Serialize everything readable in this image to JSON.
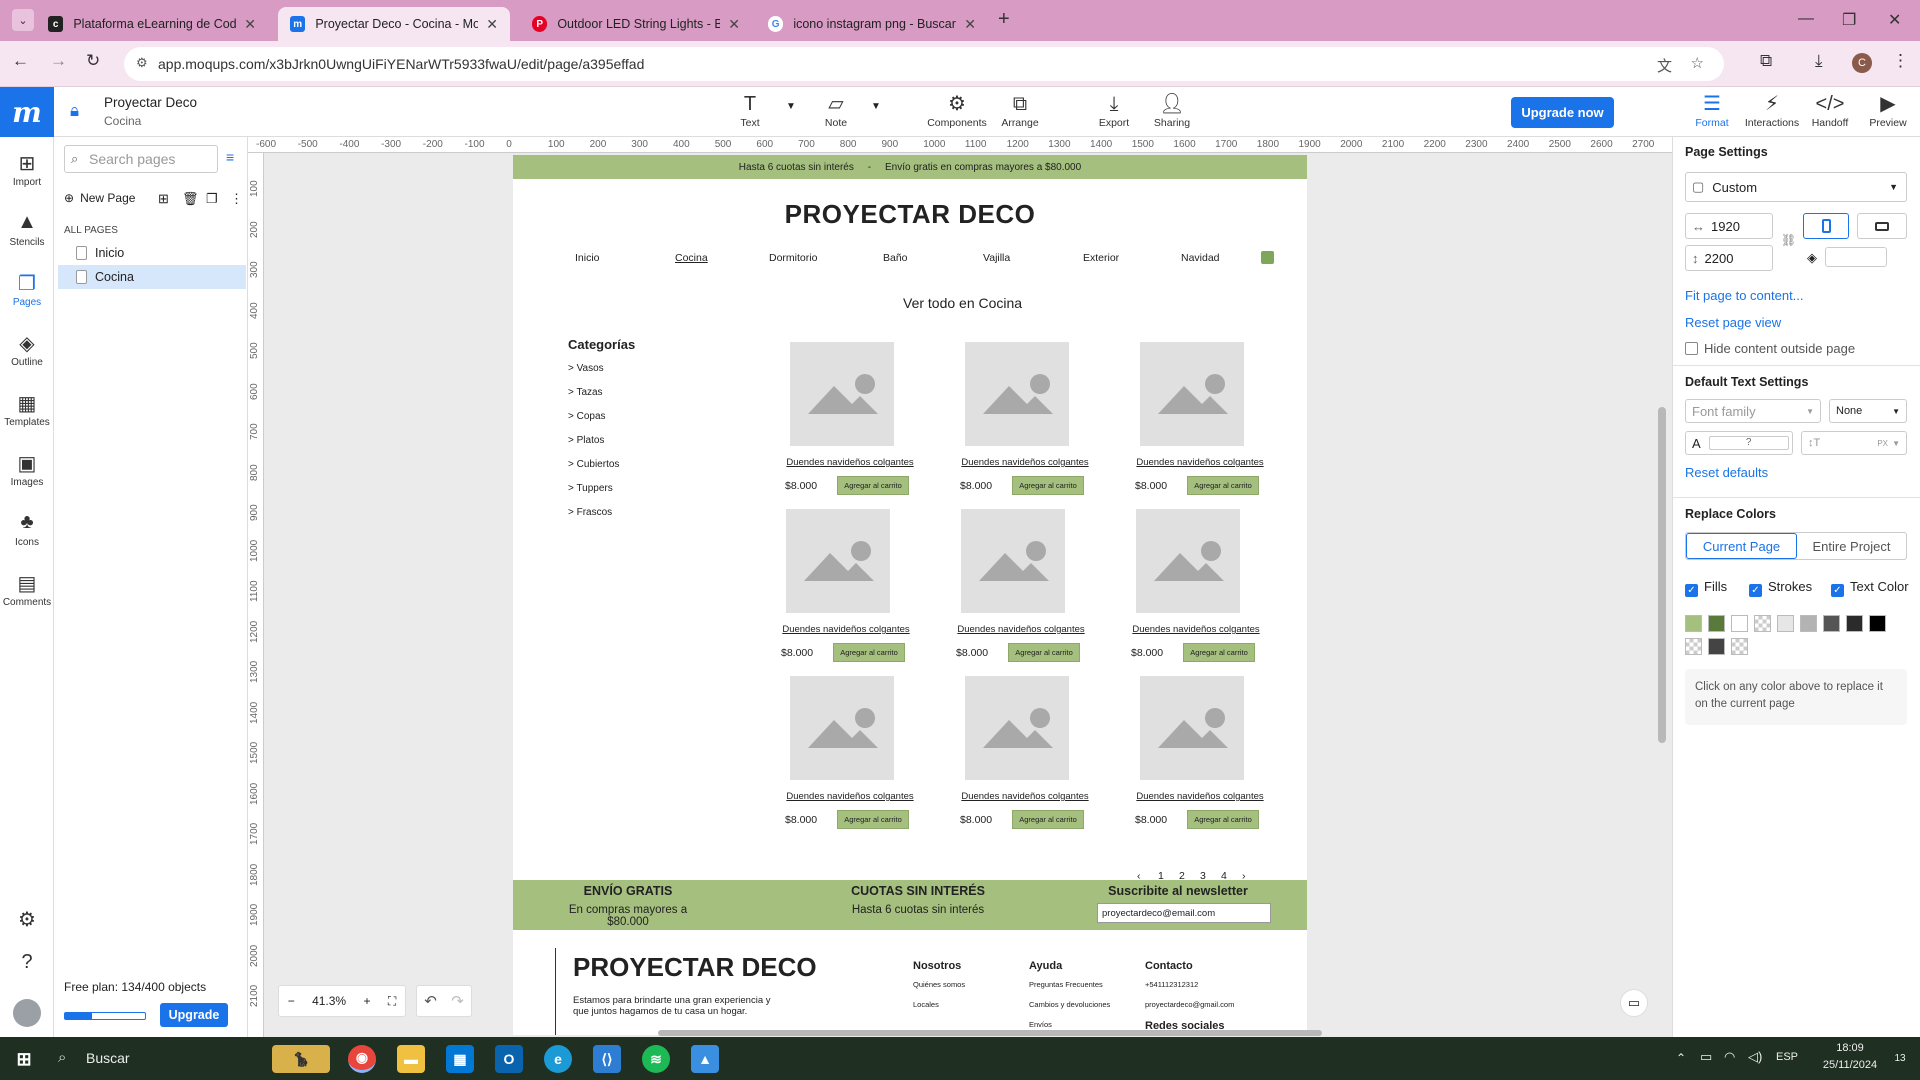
{
  "browser": {
    "tabs": [
      {
        "title": "Plataforma eLearning de Coder",
        "favicon": "coder"
      },
      {
        "title": "Proyectar Deco - Cocina - Moqu",
        "favicon": "moqups",
        "active": true
      },
      {
        "title": "Outdoor LED String Lights - Bla",
        "favicon": "pinterest"
      },
      {
        "title": "icono instagram png - Buscar c",
        "favicon": "google"
      }
    ],
    "new_tab": "+",
    "url": "app.moqups.com/x3bJrkn0UwngUiFiYENarWTr5933fwaU/edit/page/a395effad",
    "profile_initial": "C"
  },
  "app": {
    "logo": "m",
    "project_name": "Proyectar Deco",
    "page_name": "Cocina",
    "toolbar": [
      {
        "label": "Text",
        "icon": "text-icon"
      },
      {
        "label": "Note",
        "icon": "note-icon"
      },
      {
        "label": "Components",
        "icon": "components-icon"
      },
      {
        "label": "Arrange",
        "icon": "arrange-icon"
      },
      {
        "label": "Export",
        "icon": "export-icon"
      },
      {
        "label": "Sharing",
        "icon": "sharing-icon"
      }
    ],
    "upgrade_now": "Upgrade now",
    "right_tools": [
      {
        "label": "Format",
        "icon": "format-icon",
        "active": true
      },
      {
        "label": "Interactions",
        "icon": "interactions-icon"
      },
      {
        "label": "Handoff",
        "icon": "handoff-icon"
      },
      {
        "label": "Preview",
        "icon": "preview-icon"
      }
    ]
  },
  "rail": [
    {
      "label": "Import",
      "icon": "import-icon"
    },
    {
      "label": "Stencils",
      "icon": "stencils-icon"
    },
    {
      "label": "Pages",
      "icon": "pages-icon",
      "active": true
    },
    {
      "label": "Outline",
      "icon": "outline-icon"
    },
    {
      "label": "Templates",
      "icon": "templates-icon"
    },
    {
      "label": "Images",
      "icon": "images-icon"
    },
    {
      "label": "Icons",
      "icon": "icons-icon"
    },
    {
      "label": "Comments",
      "icon": "comments-icon"
    }
  ],
  "pages_panel": {
    "search_placeholder": "Search pages",
    "new_page": "New Page",
    "section": "ALL PAGES",
    "pages": [
      {
        "name": "Inicio"
      },
      {
        "name": "Cocina",
        "selected": true
      }
    ],
    "plan": "Free plan: 134/400 objects",
    "plan_usage_fraction": 0.335,
    "upgrade": "Upgrade"
  },
  "canvas": {
    "hruler": [
      "-600",
      "-500",
      "-400",
      "-300",
      "-200",
      "-100",
      "0",
      "100",
      "200",
      "300",
      "400",
      "500",
      "600",
      "700",
      "800",
      "900",
      "1000",
      "1100",
      "1200",
      "1300",
      "1400",
      "1500",
      "1600",
      "1700",
      "1800",
      "1900",
      "2000",
      "2100",
      "2200",
      "2300",
      "2400",
      "2500",
      "2600",
      "2700"
    ],
    "vruler": [
      "100",
      "200",
      "300",
      "400",
      "500",
      "600",
      "700",
      "800",
      "900",
      "1000",
      "1100",
      "1200",
      "1300",
      "1400",
      "1500",
      "1600",
      "1700",
      "1800",
      "1900",
      "2000",
      "2100"
    ],
    "zoom": "41.3%"
  },
  "mockup": {
    "promo": "Hasta 6 cuotas sin interés     -     Envío gratis en compras mayores a $80.000",
    "brand": "PROYECTAR DECO",
    "nav": [
      "Inicio",
      "Cocina",
      "Dormitorio",
      "Baño",
      "Vajilla",
      "Exterior",
      "Navidad"
    ],
    "section_title": "Ver todo en Cocina",
    "categories_title": "Categorías",
    "categories": [
      "> Vasos",
      "> Tazas",
      "> Copas",
      "> Platos",
      "> Cubiertos",
      "> Tuppers",
      "> Frascos"
    ],
    "product": {
      "name": "Duendes navideños colgantes",
      "price": "$8.000",
      "cta": "Agregar al carrito"
    },
    "pagination": [
      "‹",
      "1",
      "2",
      "3",
      "4",
      "›"
    ],
    "benefits": [
      {
        "title": "ENVÍO GRATIS",
        "text": "En compras mayores a $80.000"
      },
      {
        "title": "CUOTAS SIN INTERÉS",
        "text": "Hasta 6 cuotas sin interés"
      },
      {
        "title": "Suscribite al newsletter",
        "text": ""
      }
    ],
    "newsletter_value": "proyectardeco@email.com",
    "footer": {
      "brand": "PROYECTAR DECO",
      "desc": "Estamos para brindarte una gran experiencia y que juntos hagamos de tu casa un hogar.",
      "cols": [
        {
          "title": "Nosotros",
          "items": [
            "Quiénes somos",
            "Locales"
          ]
        },
        {
          "title": "Ayuda",
          "items": [
            "Preguntas Frecuentes",
            "Cambios y devoluciones",
            "Envíos"
          ]
        },
        {
          "title": "Contacto",
          "items": [
            "+541112312312",
            "proyectardeco@gmail.com"
          ]
        }
      ],
      "social_title": "Redes sociales"
    }
  },
  "right_panel": {
    "page_settings": "Page Settings",
    "preset": "Custom",
    "width": "1920",
    "height": "2200",
    "fit": "Fit page to content...",
    "reset_view": "Reset page view",
    "hide_outside": "Hide content outside page",
    "default_text": "Default Text Settings",
    "font_family_placeholder": "Font family",
    "font_style": "None",
    "font_size_placeholder": "?",
    "unit": "PX",
    "reset_defaults": "Reset defaults",
    "replace_colors": "Replace Colors",
    "tab_current": "Current Page",
    "tab_entire": "Entire Project",
    "fills": "Fills",
    "strokes": "Strokes",
    "text_color": "Text Color",
    "swatches": [
      "#a4bf7e",
      "#5a7a3a",
      "#ffffff",
      "checker",
      "#e6e6e6",
      "#b3b3b3",
      "#555555",
      "#2b2b2b",
      "#000000",
      "checker",
      "#444444",
      "checker"
    ],
    "hint": "Click on any color above to replace it on the current page"
  },
  "taskbar": {
    "search": "Buscar",
    "lang": "ESP",
    "time": "18:09",
    "date": "25/11/2024",
    "notif": "13"
  },
  "colors": {
    "accent": "#1a73e8",
    "green": "#a4bf7e",
    "tabstrip": "#d79bc4"
  }
}
